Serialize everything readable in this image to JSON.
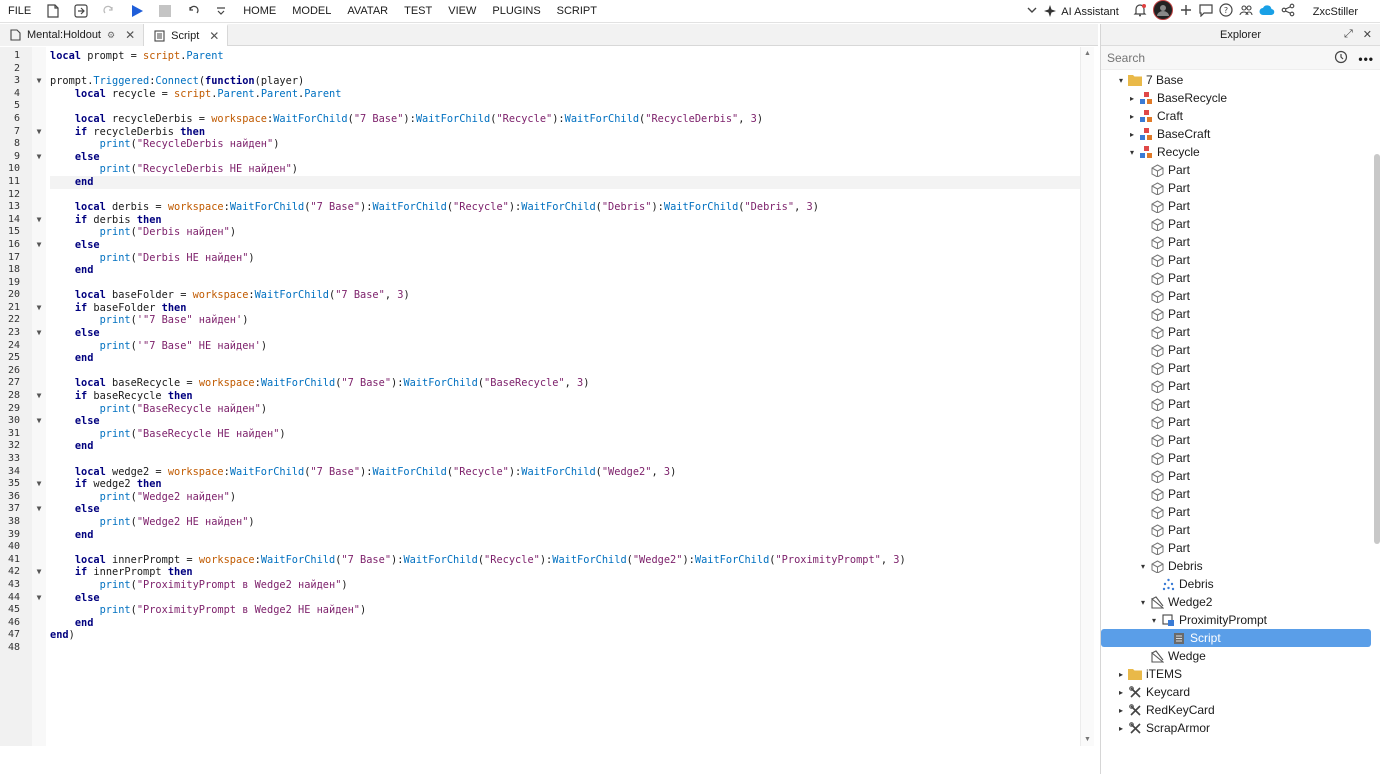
{
  "menubar": {
    "file": "FILE",
    "items": [
      "HOME",
      "MODEL",
      "AVATAR",
      "TEST",
      "VIEW",
      "PLUGINS",
      "SCRIPT"
    ],
    "ai_label": "AI Assistant",
    "username": "ZxcStiller"
  },
  "tabs": [
    {
      "label": "Mental:Holdout",
      "close": "✕"
    },
    {
      "label": "Script",
      "close": "✕"
    }
  ],
  "editor": {
    "current_line": 11,
    "lines": [
      {
        "n": "1",
        "html": "<span class='kw'>local</span> prompt = <span class='gl'>script</span>.<span class='fn'>Parent</span>"
      },
      {
        "n": "2",
        "html": ""
      },
      {
        "n": "3",
        "fold": true,
        "html": "prompt.<span class='fn'>Triggered</span>:<span class='fn'>Connect</span>(<span class='kw'>function</span>(player)"
      },
      {
        "n": "4",
        "html": "    <span class='kw'>local</span> recycle = <span class='gl'>script</span>.<span class='fn'>Parent</span>.<span class='fn'>Parent</span>.<span class='fn'>Parent</span>"
      },
      {
        "n": "5",
        "html": ""
      },
      {
        "n": "6",
        "html": "    <span class='kw'>local</span> recycleDerbis = <span class='gl'>workspace</span>:<span class='fn'>WaitForChild</span>(<span class='st'>\"7 Base\"</span>):<span class='fn'>WaitForChild</span>(<span class='st'>\"Recycle\"</span>):<span class='fn'>WaitForChild</span>(<span class='st'>\"RecycleDerbis\"</span>, <span class='nu'>3</span>)"
      },
      {
        "n": "7",
        "fold": true,
        "html": "    <span class='kw'>if</span> recycleDerbis <span class='kw'>then</span>"
      },
      {
        "n": "8",
        "html": "        <span class='fn'>print</span>(<span class='st'>\"RecycleDerbis найден\"</span>)"
      },
      {
        "n": "9",
        "fold": true,
        "html": "    <span class='kw'>else</span>"
      },
      {
        "n": "10",
        "html": "        <span class='fn'>print</span>(<span class='st'>\"RecycleDerbis НЕ найден\"</span>)"
      },
      {
        "n": "11",
        "html": "    <span class='kw'>end</span>"
      },
      {
        "n": "12",
        "html": ""
      },
      {
        "n": "13",
        "html": "    <span class='kw'>local</span> derbis = <span class='gl'>workspace</span>:<span class='fn'>WaitForChild</span>(<span class='st'>\"7 Base\"</span>):<span class='fn'>WaitForChild</span>(<span class='st'>\"Recycle\"</span>):<span class='fn'>WaitForChild</span>(<span class='st'>\"Debris\"</span>):<span class='fn'>WaitForChild</span>(<span class='st'>\"Debris\"</span>, <span class='nu'>3</span>)"
      },
      {
        "n": "14",
        "fold": true,
        "html": "    <span class='kw'>if</span> derbis <span class='kw'>then</span>"
      },
      {
        "n": "15",
        "html": "        <span class='fn'>print</span>(<span class='st'>\"Derbis найден\"</span>)"
      },
      {
        "n": "16",
        "fold": true,
        "html": "    <span class='kw'>else</span>"
      },
      {
        "n": "17",
        "html": "        <span class='fn'>print</span>(<span class='st'>\"Derbis НЕ найден\"</span>)"
      },
      {
        "n": "18",
        "html": "    <span class='kw'>end</span>"
      },
      {
        "n": "19",
        "html": ""
      },
      {
        "n": "20",
        "html": "    <span class='kw'>local</span> baseFolder = <span class='gl'>workspace</span>:<span class='fn'>WaitForChild</span>(<span class='st'>\"7 Base\"</span>, <span class='nu'>3</span>)"
      },
      {
        "n": "21",
        "fold": true,
        "html": "    <span class='kw'>if</span> baseFolder <span class='kw'>then</span>"
      },
      {
        "n": "22",
        "html": "        <span class='fn'>print</span>(<span class='st'>'\"7 Base\" найден'</span>)"
      },
      {
        "n": "23",
        "fold": true,
        "html": "    <span class='kw'>else</span>"
      },
      {
        "n": "24",
        "html": "        <span class='fn'>print</span>(<span class='st'>'\"7 Base\" НЕ найден'</span>)"
      },
      {
        "n": "25",
        "html": "    <span class='kw'>end</span>"
      },
      {
        "n": "26",
        "html": ""
      },
      {
        "n": "27",
        "html": "    <span class='kw'>local</span> baseRecycle = <span class='gl'>workspace</span>:<span class='fn'>WaitForChild</span>(<span class='st'>\"7 Base\"</span>):<span class='fn'>WaitForChild</span>(<span class='st'>\"BaseRecycle\"</span>, <span class='nu'>3</span>)"
      },
      {
        "n": "28",
        "fold": true,
        "html": "    <span class='kw'>if</span> baseRecycle <span class='kw'>then</span>"
      },
      {
        "n": "29",
        "html": "        <span class='fn'>print</span>(<span class='st'>\"BaseRecycle найден\"</span>)"
      },
      {
        "n": "30",
        "fold": true,
        "html": "    <span class='kw'>else</span>"
      },
      {
        "n": "31",
        "html": "        <span class='fn'>print</span>(<span class='st'>\"BaseRecycle НЕ найден\"</span>)"
      },
      {
        "n": "32",
        "html": "    <span class='kw'>end</span>"
      },
      {
        "n": "33",
        "html": ""
      },
      {
        "n": "34",
        "html": "    <span class='kw'>local</span> wedge2 = <span class='gl'>workspace</span>:<span class='fn'>WaitForChild</span>(<span class='st'>\"7 Base\"</span>):<span class='fn'>WaitForChild</span>(<span class='st'>\"Recycle\"</span>):<span class='fn'>WaitForChild</span>(<span class='st'>\"Wedge2\"</span>, <span class='nu'>3</span>)"
      },
      {
        "n": "35",
        "fold": true,
        "html": "    <span class='kw'>if</span> wedge2 <span class='kw'>then</span>"
      },
      {
        "n": "36",
        "html": "        <span class='fn'>print</span>(<span class='st'>\"Wedge2 найден\"</span>)"
      },
      {
        "n": "37",
        "fold": true,
        "html": "    <span class='kw'>else</span>"
      },
      {
        "n": "38",
        "html": "        <span class='fn'>print</span>(<span class='st'>\"Wedge2 НЕ найден\"</span>)"
      },
      {
        "n": "39",
        "html": "    <span class='kw'>end</span>"
      },
      {
        "n": "40",
        "html": ""
      },
      {
        "n": "41",
        "html": "    <span class='kw'>local</span> innerPrompt = <span class='gl'>workspace</span>:<span class='fn'>WaitForChild</span>(<span class='st'>\"7 Base\"</span>):<span class='fn'>WaitForChild</span>(<span class='st'>\"Recycle\"</span>):<span class='fn'>WaitForChild</span>(<span class='st'>\"Wedge2\"</span>):<span class='fn'>WaitForChild</span>(<span class='st'>\"ProximityPrompt\"</span>, <span class='nu'>3</span>)"
      },
      {
        "n": "42",
        "fold": true,
        "html": "    <span class='kw'>if</span> innerPrompt <span class='kw'>then</span>"
      },
      {
        "n": "43",
        "html": "        <span class='fn'>print</span>(<span class='st'>\"ProximityPrompt в Wedge2 найден\"</span>)"
      },
      {
        "n": "44",
        "fold": true,
        "html": "    <span class='kw'>else</span>"
      },
      {
        "n": "45",
        "html": "        <span class='fn'>print</span>(<span class='st'>\"ProximityPrompt в Wedge2 НЕ найден\"</span>)"
      },
      {
        "n": "46",
        "html": "    <span class='kw'>end</span>"
      },
      {
        "n": "47",
        "html": "<span class='kw'>end</span>)"
      },
      {
        "n": "48",
        "html": ""
      }
    ]
  },
  "explorer": {
    "title": "Explorer",
    "search_placeholder": "Search",
    "nodes": [
      {
        "label": "7 Base",
        "indent": 1,
        "arrow": "▾",
        "icon": "folder-icon"
      },
      {
        "label": "BaseRecycle",
        "indent": 2,
        "arrow": "▸",
        "icon": "model-icon"
      },
      {
        "label": "Craft",
        "indent": 2,
        "arrow": "▸",
        "icon": "model-icon"
      },
      {
        "label": "BaseCraft",
        "indent": 2,
        "arrow": "▸",
        "icon": "model-icon"
      },
      {
        "label": "Recycle",
        "indent": 2,
        "arrow": "▾",
        "icon": "model-icon"
      },
      {
        "label": "Part",
        "indent": 3,
        "arrow": "",
        "icon": "part-icon"
      },
      {
        "label": "Part",
        "indent": 3,
        "arrow": "",
        "icon": "part-icon"
      },
      {
        "label": "Part",
        "indent": 3,
        "arrow": "",
        "icon": "part-icon"
      },
      {
        "label": "Part",
        "indent": 3,
        "arrow": "",
        "icon": "part-icon"
      },
      {
        "label": "Part",
        "indent": 3,
        "arrow": "",
        "icon": "part-icon"
      },
      {
        "label": "Part",
        "indent": 3,
        "arrow": "",
        "icon": "part-icon"
      },
      {
        "label": "Part",
        "indent": 3,
        "arrow": "",
        "icon": "part-icon"
      },
      {
        "label": "Part",
        "indent": 3,
        "arrow": "",
        "icon": "part-icon"
      },
      {
        "label": "Part",
        "indent": 3,
        "arrow": "",
        "icon": "part-icon"
      },
      {
        "label": "Part",
        "indent": 3,
        "arrow": "",
        "icon": "part-icon"
      },
      {
        "label": "Part",
        "indent": 3,
        "arrow": "",
        "icon": "part-icon"
      },
      {
        "label": "Part",
        "indent": 3,
        "arrow": "",
        "icon": "part-icon"
      },
      {
        "label": "Part",
        "indent": 3,
        "arrow": "",
        "icon": "part-icon"
      },
      {
        "label": "Part",
        "indent": 3,
        "arrow": "",
        "icon": "part-icon"
      },
      {
        "label": "Part",
        "indent": 3,
        "arrow": "",
        "icon": "part-icon"
      },
      {
        "label": "Part",
        "indent": 3,
        "arrow": "",
        "icon": "part-icon"
      },
      {
        "label": "Part",
        "indent": 3,
        "arrow": "",
        "icon": "part-icon"
      },
      {
        "label": "Part",
        "indent": 3,
        "arrow": "",
        "icon": "part-icon"
      },
      {
        "label": "Part",
        "indent": 3,
        "arrow": "",
        "icon": "part-icon"
      },
      {
        "label": "Part",
        "indent": 3,
        "arrow": "",
        "icon": "part-icon"
      },
      {
        "label": "Part",
        "indent": 3,
        "arrow": "",
        "icon": "part-icon"
      },
      {
        "label": "Part",
        "indent": 3,
        "arrow": "",
        "icon": "part-icon"
      },
      {
        "label": "Debris",
        "indent": 3,
        "arrow": "▾",
        "icon": "part-icon"
      },
      {
        "label": "Debris",
        "indent": 4,
        "arrow": "",
        "icon": "particles-icon"
      },
      {
        "label": "Wedge2",
        "indent": 3,
        "arrow": "▾",
        "icon": "wedge-icon"
      },
      {
        "label": "ProximityPrompt",
        "indent": 4,
        "arrow": "▾",
        "icon": "proximity-prompt-icon"
      },
      {
        "label": "Script",
        "indent": 5,
        "arrow": "",
        "icon": "script-icon",
        "selected": true
      },
      {
        "label": "Wedge",
        "indent": 3,
        "arrow": "",
        "icon": "wedge-icon"
      },
      {
        "label": "iTEMS",
        "indent": 1,
        "arrow": "▸",
        "icon": "folder-icon"
      },
      {
        "label": "Keycard",
        "indent": 1,
        "arrow": "▸",
        "icon": "tool-icon"
      },
      {
        "label": "RedKeyCard",
        "indent": 1,
        "arrow": "▸",
        "icon": "tool-icon"
      },
      {
        "label": "ScrapArmor",
        "indent": 1,
        "arrow": "▸",
        "icon": "tool-icon"
      }
    ]
  },
  "colors": {
    "keyword": "#00007f",
    "function": "#0070c0",
    "global": "#c05a00",
    "string": "#7c1f6a",
    "selection": "#5a9ee8",
    "play": "#1f5ed9"
  }
}
